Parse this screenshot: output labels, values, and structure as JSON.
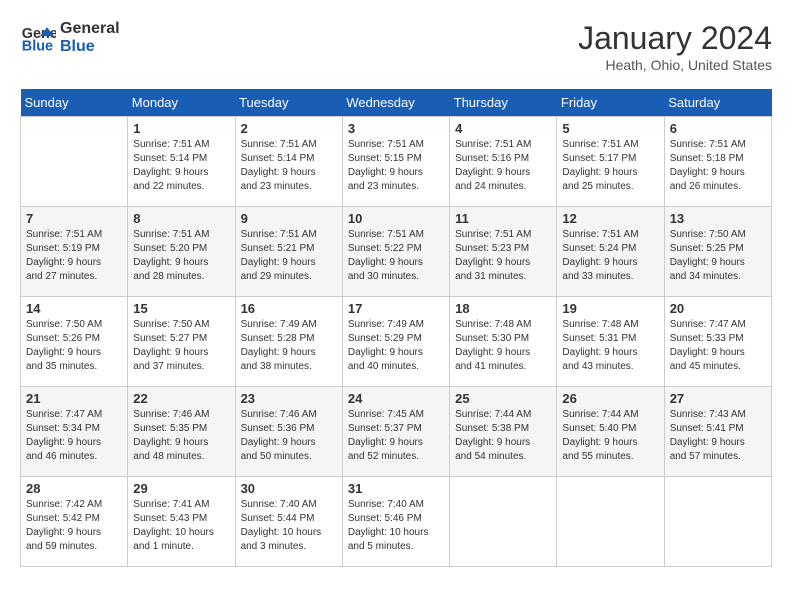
{
  "logo": {
    "line1": "General",
    "line2": "Blue"
  },
  "title": "January 2024",
  "location": "Heath, Ohio, United States",
  "weekdays": [
    "Sunday",
    "Monday",
    "Tuesday",
    "Wednesday",
    "Thursday",
    "Friday",
    "Saturday"
  ],
  "weeks": [
    [
      {
        "day": "",
        "info": ""
      },
      {
        "day": "1",
        "info": "Sunrise: 7:51 AM\nSunset: 5:14 PM\nDaylight: 9 hours\nand 22 minutes."
      },
      {
        "day": "2",
        "info": "Sunrise: 7:51 AM\nSunset: 5:14 PM\nDaylight: 9 hours\nand 23 minutes."
      },
      {
        "day": "3",
        "info": "Sunrise: 7:51 AM\nSunset: 5:15 PM\nDaylight: 9 hours\nand 23 minutes."
      },
      {
        "day": "4",
        "info": "Sunrise: 7:51 AM\nSunset: 5:16 PM\nDaylight: 9 hours\nand 24 minutes."
      },
      {
        "day": "5",
        "info": "Sunrise: 7:51 AM\nSunset: 5:17 PM\nDaylight: 9 hours\nand 25 minutes."
      },
      {
        "day": "6",
        "info": "Sunrise: 7:51 AM\nSunset: 5:18 PM\nDaylight: 9 hours\nand 26 minutes."
      }
    ],
    [
      {
        "day": "7",
        "info": "Sunrise: 7:51 AM\nSunset: 5:19 PM\nDaylight: 9 hours\nand 27 minutes."
      },
      {
        "day": "8",
        "info": "Sunrise: 7:51 AM\nSunset: 5:20 PM\nDaylight: 9 hours\nand 28 minutes."
      },
      {
        "day": "9",
        "info": "Sunrise: 7:51 AM\nSunset: 5:21 PM\nDaylight: 9 hours\nand 29 minutes."
      },
      {
        "day": "10",
        "info": "Sunrise: 7:51 AM\nSunset: 5:22 PM\nDaylight: 9 hours\nand 30 minutes."
      },
      {
        "day": "11",
        "info": "Sunrise: 7:51 AM\nSunset: 5:23 PM\nDaylight: 9 hours\nand 31 minutes."
      },
      {
        "day": "12",
        "info": "Sunrise: 7:51 AM\nSunset: 5:24 PM\nDaylight: 9 hours\nand 33 minutes."
      },
      {
        "day": "13",
        "info": "Sunrise: 7:50 AM\nSunset: 5:25 PM\nDaylight: 9 hours\nand 34 minutes."
      }
    ],
    [
      {
        "day": "14",
        "info": "Sunrise: 7:50 AM\nSunset: 5:26 PM\nDaylight: 9 hours\nand 35 minutes."
      },
      {
        "day": "15",
        "info": "Sunrise: 7:50 AM\nSunset: 5:27 PM\nDaylight: 9 hours\nand 37 minutes."
      },
      {
        "day": "16",
        "info": "Sunrise: 7:49 AM\nSunset: 5:28 PM\nDaylight: 9 hours\nand 38 minutes."
      },
      {
        "day": "17",
        "info": "Sunrise: 7:49 AM\nSunset: 5:29 PM\nDaylight: 9 hours\nand 40 minutes."
      },
      {
        "day": "18",
        "info": "Sunrise: 7:48 AM\nSunset: 5:30 PM\nDaylight: 9 hours\nand 41 minutes."
      },
      {
        "day": "19",
        "info": "Sunrise: 7:48 AM\nSunset: 5:31 PM\nDaylight: 9 hours\nand 43 minutes."
      },
      {
        "day": "20",
        "info": "Sunrise: 7:47 AM\nSunset: 5:33 PM\nDaylight: 9 hours\nand 45 minutes."
      }
    ],
    [
      {
        "day": "21",
        "info": "Sunrise: 7:47 AM\nSunset: 5:34 PM\nDaylight: 9 hours\nand 46 minutes."
      },
      {
        "day": "22",
        "info": "Sunrise: 7:46 AM\nSunset: 5:35 PM\nDaylight: 9 hours\nand 48 minutes."
      },
      {
        "day": "23",
        "info": "Sunrise: 7:46 AM\nSunset: 5:36 PM\nDaylight: 9 hours\nand 50 minutes."
      },
      {
        "day": "24",
        "info": "Sunrise: 7:45 AM\nSunset: 5:37 PM\nDaylight: 9 hours\nand 52 minutes."
      },
      {
        "day": "25",
        "info": "Sunrise: 7:44 AM\nSunset: 5:38 PM\nDaylight: 9 hours\nand 54 minutes."
      },
      {
        "day": "26",
        "info": "Sunrise: 7:44 AM\nSunset: 5:40 PM\nDaylight: 9 hours\nand 55 minutes."
      },
      {
        "day": "27",
        "info": "Sunrise: 7:43 AM\nSunset: 5:41 PM\nDaylight: 9 hours\nand 57 minutes."
      }
    ],
    [
      {
        "day": "28",
        "info": "Sunrise: 7:42 AM\nSunset: 5:42 PM\nDaylight: 9 hours\nand 59 minutes."
      },
      {
        "day": "29",
        "info": "Sunrise: 7:41 AM\nSunset: 5:43 PM\nDaylight: 10 hours\nand 1 minute."
      },
      {
        "day": "30",
        "info": "Sunrise: 7:40 AM\nSunset: 5:44 PM\nDaylight: 10 hours\nand 3 minutes."
      },
      {
        "day": "31",
        "info": "Sunrise: 7:40 AM\nSunset: 5:46 PM\nDaylight: 10 hours\nand 5 minutes."
      },
      {
        "day": "",
        "info": ""
      },
      {
        "day": "",
        "info": ""
      },
      {
        "day": "",
        "info": ""
      }
    ]
  ]
}
